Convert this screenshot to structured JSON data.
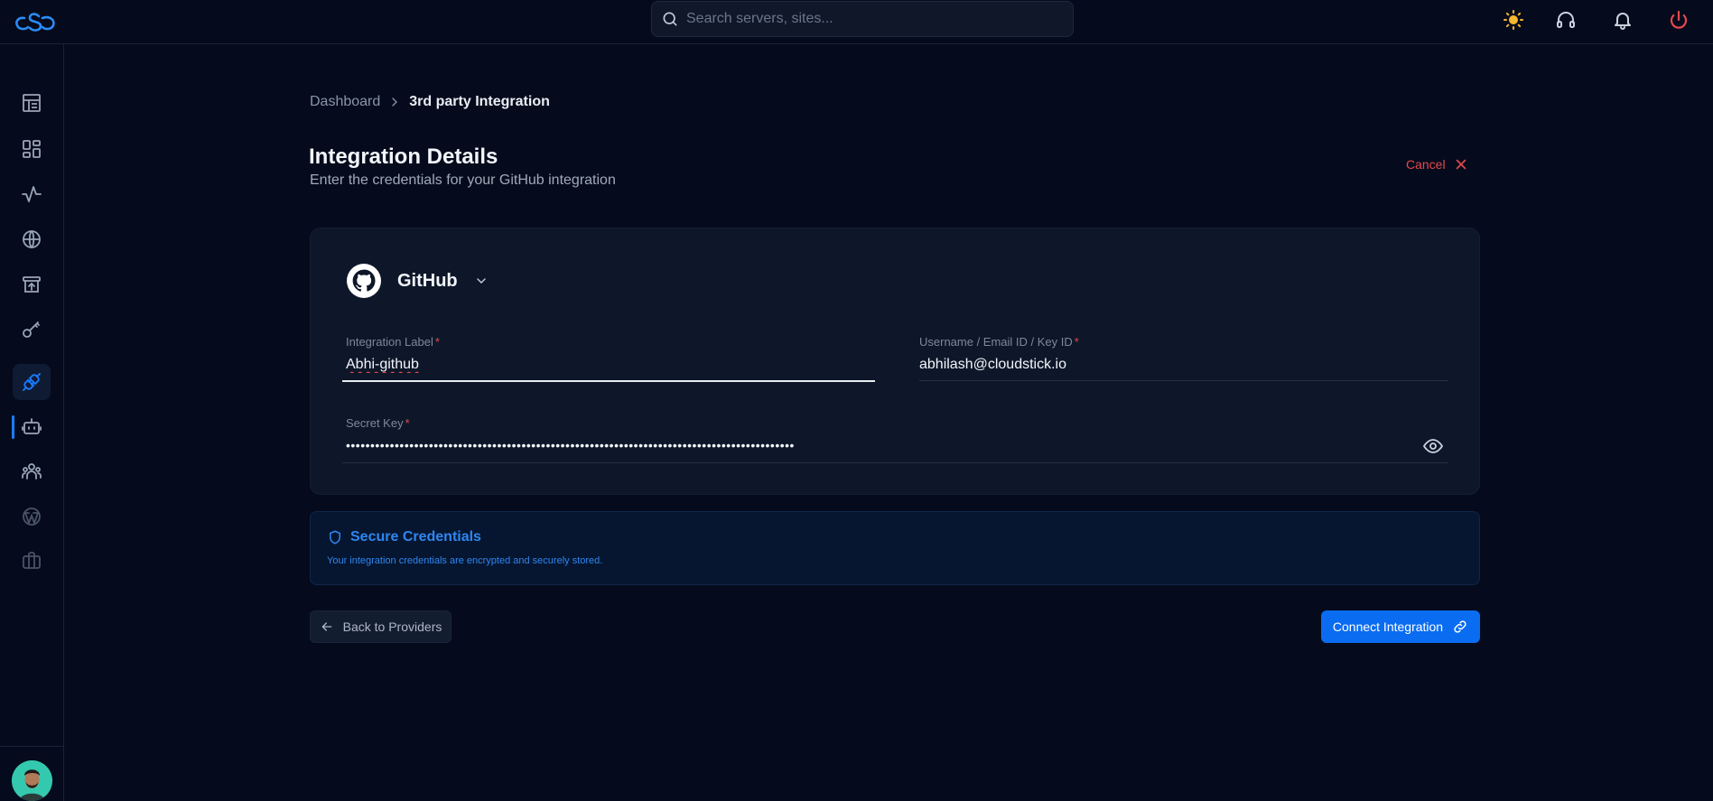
{
  "search": {
    "placeholder": "Search servers, sites..."
  },
  "topbar": {
    "icons": [
      "logo-icon",
      "sun-icon",
      "headphones-icon",
      "bell-icon",
      "power-icon"
    ]
  },
  "sidebar": {
    "items": [
      {
        "icon": "dashboard-icon"
      },
      {
        "icon": "grid-icon"
      },
      {
        "icon": "activity-icon"
      },
      {
        "icon": "globe-icon"
      },
      {
        "icon": "archive-upload-icon"
      },
      {
        "icon": "key-icon"
      },
      {
        "icon": "plug-icon",
        "active": true
      },
      {
        "icon": "bot-icon"
      },
      {
        "icon": "team-icon"
      },
      {
        "icon": "wordpress-icon"
      },
      {
        "icon": "briefcase-icon"
      }
    ]
  },
  "breadcrumb": {
    "home": "Dashboard",
    "current": "3rd party Integration"
  },
  "header": {
    "title": "Integration Details",
    "subtitle": "Enter the credentials for your GitHub integration",
    "cancel_label": "Cancel"
  },
  "provider": {
    "name": "GitHub",
    "icon": "github-icon"
  },
  "fields": {
    "label": {
      "label": "Integration Label",
      "required": "*",
      "value": "Abhi-github"
    },
    "username": {
      "label": "Username / Email ID / Key ID",
      "required": "*",
      "value": "abhilash@cloudstick.io"
    },
    "secret": {
      "label": "Secret Key",
      "required": "*",
      "value": "••••••••••••••••••••••••••••••••••••••••••••••••••••••••••••••••••••••••••••••••••••••••••••"
    }
  },
  "secure": {
    "title": "Secure Credentials",
    "description": "Your integration credentials are encrypted and securely stored."
  },
  "actions": {
    "back_label": "Back to Providers",
    "connect_label": "Connect Integration"
  },
  "colors": {
    "background": "#050b1c",
    "card": "#0e1729",
    "accent": "#0a6cf0",
    "danger": "#e5484d",
    "sun": "#f5b82e"
  }
}
